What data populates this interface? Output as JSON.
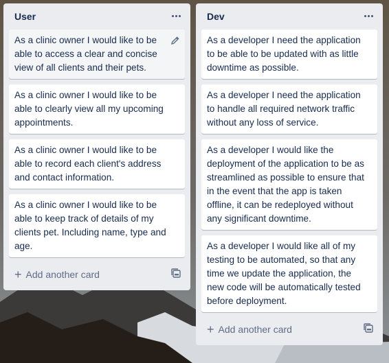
{
  "lists": [
    {
      "title": "User",
      "cards": [
        "As a clinic owner I would like to be able to access a clear and concise view of all clients and their pets.",
        "As a clinic owner I would like to be able to clearly view all my upcoming appointments.",
        "As a clinic owner I would like to be able to record each client's address and contact information.",
        "As a clinic owner I would like to be able to keep track of details of my clients pet. Including name, type and age."
      ],
      "add_label": "Add another card"
    },
    {
      "title": "Dev",
      "cards": [
        "As a developer I need the application to be able to be updated with as little downtime as possible.",
        "As a developer I need the application to handle all required network traffic without any loss of service.",
        "As a developer I would like the deployment of the application to be as streamlined as possible to ensure that in the event that the app is taken offline, it can be redeployed without any significant downtime.",
        "As a developer I would like all of my testing to be automated, so that any time we update the application, the new code will be automatically tested before deployment."
      ],
      "add_label": "Add another card"
    }
  ],
  "icons": {
    "list_menu": "ellipsis-icon",
    "card_edit": "pencil-icon",
    "add": "plus-icon",
    "template": "card-template-icon"
  }
}
